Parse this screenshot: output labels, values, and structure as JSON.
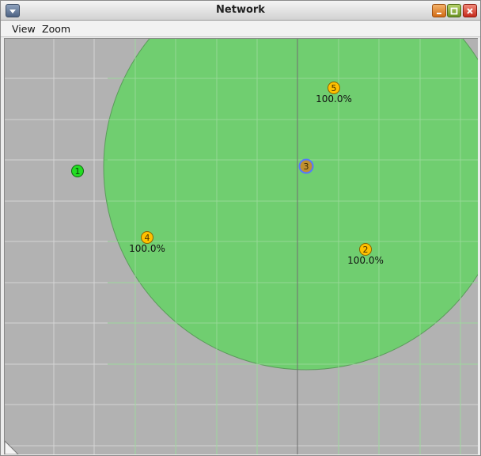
{
  "window": {
    "title": "Network"
  },
  "menu": {
    "view": "View",
    "zoom": "Zoom"
  },
  "colors": {
    "canvas_bg": "#b2b2b2",
    "coverage": "#6dce6d",
    "node_green": "#22dd22",
    "node_orange": "#ffc000",
    "node_selected_fill": "#c09030",
    "node_selected_ring": "#5577ff",
    "grid": "#d8d8d8"
  },
  "nodes": [
    {
      "id": "1",
      "label": ""
    },
    {
      "id": "2",
      "label": "100.0%"
    },
    {
      "id": "3",
      "label": ""
    },
    {
      "id": "4",
      "label": "100.0%"
    },
    {
      "id": "5",
      "label": "100.0%"
    }
  ]
}
